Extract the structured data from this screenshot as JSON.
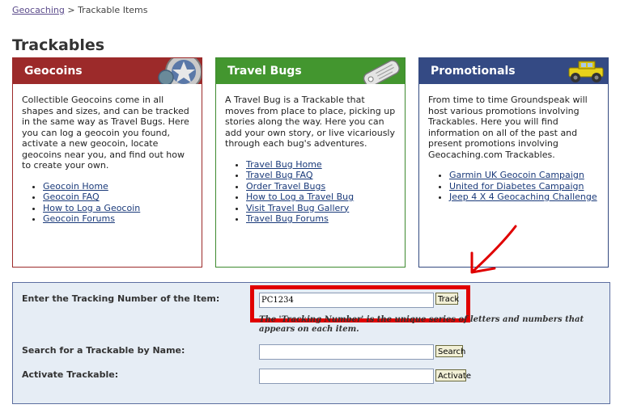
{
  "breadcrumb": {
    "home": "Geocaching",
    "separator": ">",
    "current": "Trackable Items"
  },
  "page_title": "Trackables",
  "panels": [
    {
      "title": "Geocoins",
      "description": "Collectible Geocoins come in all shapes and sizes, and can be tracked in the same way as Travel Bugs. Here you can log a geocoin you found, activate a new geocoin, locate geocoins near you, and find out how to create your own.",
      "links": [
        "Geocoin Home",
        "Geocoin FAQ",
        "How to Log a Geocoin",
        "Geocoin Forums"
      ]
    },
    {
      "title": "Travel Bugs",
      "description": "A Travel Bug is a Trackable that moves from place to place, picking up stories along the way. Here you can add your own story, or live vicariously through each bug's adventures.",
      "links": [
        "Travel Bug Home",
        "Travel Bug FAQ",
        "Order Travel Bugs",
        "How to Log a Travel Bug",
        "Visit Travel Bug Gallery",
        "Travel Bug Forums"
      ]
    },
    {
      "title": "Promotionals",
      "description": "From time to time Groundspeak will host various promotions involving Trackables. Here you will find information on all of the past and present promotions involving Geocaching.com Trackables.",
      "links": [
        "Garmin UK Geocoin Campaign",
        "United for Diabetes Campaign",
        "Jeep 4 X 4 Geocaching Challenge"
      ]
    }
  ],
  "tracking": {
    "label": "Enter the Tracking Number of the Item:",
    "value": "PC1234",
    "button": "Track",
    "hint": "The 'Tracking Number' is the unique series of letters and numbers that appears on each item."
  },
  "search": {
    "label": "Search for a Trackable by Name:",
    "value": "",
    "button": "Search"
  },
  "activate": {
    "label": "Activate Trackable:",
    "value": "",
    "button": "Activate"
  },
  "colors": {
    "geocoins_header": "#9c2a2a",
    "travel_bugs_header": "#43962f",
    "promotionals_header": "#344a84",
    "highlight": "#e00000",
    "form_background": "#e6edf5"
  },
  "icons": {
    "geocoins": "geocoin-medal-icon",
    "travel_bugs": "travel-bug-tag-icon",
    "promotionals": "yellow-jeep-icon",
    "annotation": "red-arrow-icon"
  }
}
